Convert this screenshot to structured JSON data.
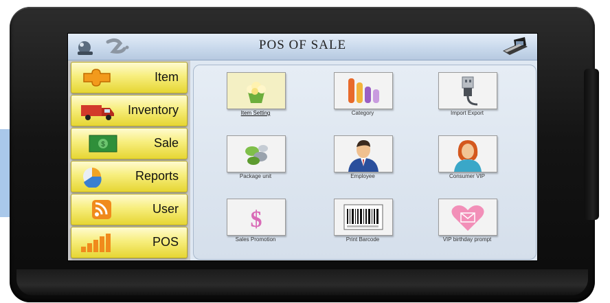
{
  "header": {
    "title": "POS OF SALE"
  },
  "sidebar": {
    "items": [
      {
        "label": "Item",
        "icon": "puzzle-icon"
      },
      {
        "label": "Inventory",
        "icon": "truck-icon"
      },
      {
        "label": "Sale",
        "icon": "cash-icon"
      },
      {
        "label": "Reports",
        "icon": "pie-chart-icon"
      },
      {
        "label": "User",
        "icon": "rss-icon"
      },
      {
        "label": "POS",
        "icon": "bar-graph-icon"
      }
    ]
  },
  "main": {
    "tiles": [
      {
        "label": "Item Setting",
        "icon": "popcorn-icon",
        "selected": true
      },
      {
        "label": "Category",
        "icon": "category-bars-icon"
      },
      {
        "label": "Import Export",
        "icon": "usb-plug-icon"
      },
      {
        "label": "Package unit",
        "icon": "package-cylinders-icon"
      },
      {
        "label": "Employee",
        "icon": "employee-icon"
      },
      {
        "label": "Consumer VIP",
        "icon": "vip-woman-icon"
      },
      {
        "label": "Sales Promotion",
        "icon": "dollar-sign-icon"
      },
      {
        "label": "Print Barcode",
        "icon": "barcode-icon"
      },
      {
        "label": "VIP birthday prompt",
        "icon": "heart-envelope-icon"
      }
    ]
  },
  "colors": {
    "sidebar_button": "#f7ee7d",
    "title_bar": "#c9d9ec",
    "device_frame": "#141414"
  }
}
